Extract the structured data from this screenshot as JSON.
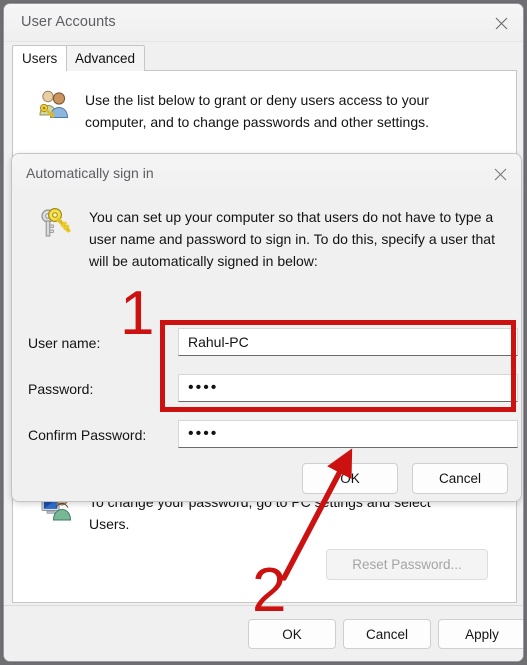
{
  "window": {
    "title": "User Accounts",
    "close_label": "close-window"
  },
  "tabs": [
    {
      "label": "Users",
      "active": true
    },
    {
      "label": "Advanced",
      "active": false
    }
  ],
  "main": {
    "intro_text": "Use the list below to grant or deny users access to your computer, and to change passwords and other settings.",
    "intro_icon": "users-key-icon",
    "password_info_text": "To change your password, go to PC settings and select Users.",
    "password_info_icon": "pc-user-icon",
    "reset_password_button": "Reset Password...",
    "reset_password_disabled": true
  },
  "bottom_buttons": {
    "ok": "OK",
    "cancel": "Cancel",
    "apply": "Apply"
  },
  "dialog": {
    "title": "Automatically sign in",
    "close_label": "close-dialog",
    "icon": "keys-icon",
    "description": "You can set up your computer so that users do not have to type a user name and password to sign in. To do this, specify a user that will be automatically signed in below:",
    "fields": [
      {
        "label": "User name:",
        "value": "Rahul-PC",
        "type": "text"
      },
      {
        "label": "Password:",
        "value": "••••",
        "type": "password"
      },
      {
        "label": "Confirm Password:",
        "value": "••••",
        "type": "password"
      }
    ],
    "buttons": {
      "ok": "OK",
      "cancel": "Cancel"
    }
  },
  "annotations": {
    "step_one": "1",
    "step_two": "2",
    "highlight_color": "#cc1111",
    "arrow": "arrow pointing up-right to the dialog OK button"
  }
}
